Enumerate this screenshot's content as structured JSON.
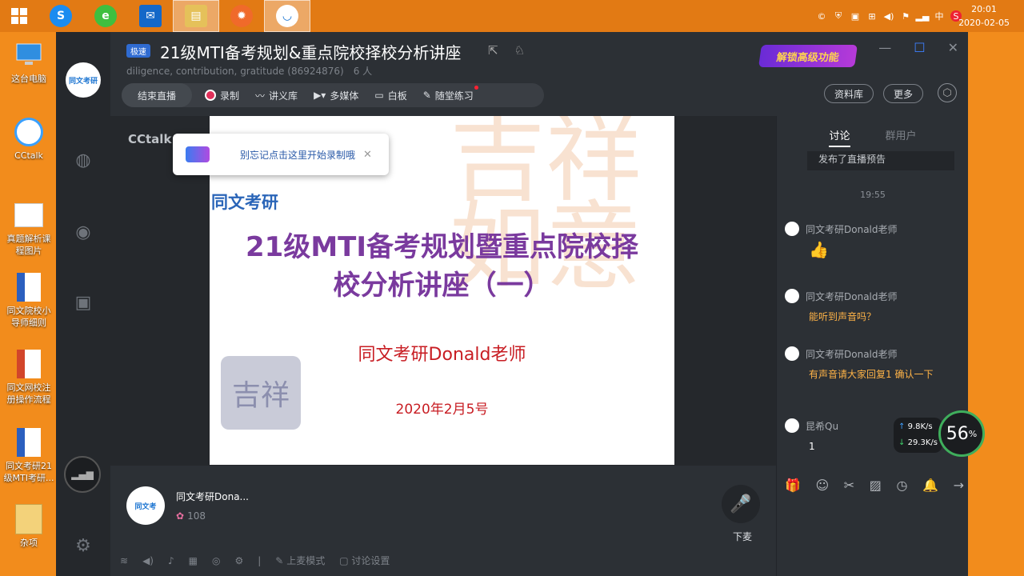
{
  "taskbar": {
    "tray_lang": "中",
    "tray_s": "S",
    "time": "20:01",
    "date": "2020-02-05"
  },
  "desktop": {
    "icons": [
      "这台电脑",
      "CCtalk",
      "真题解析课程图片",
      "同文院校小导师细则",
      "同文网校注册操作流程",
      "同文考研21级MTI考研...",
      "杂项"
    ]
  },
  "header": {
    "badge": "极速",
    "title": "21级MTI备考规划&重点院校择校分析讲座",
    "subtitle": "diligence, contribution, gratitude (86924876)",
    "member_count": "6 人",
    "unlock_label": "解锁高级功能"
  },
  "toolbar": {
    "end_live": "结束直播",
    "record": "录制",
    "handout": "讲义库",
    "multimedia": "多媒体",
    "whiteboard": "白板",
    "exercise": "随堂练习",
    "materials": "资料库",
    "more": "更多"
  },
  "stage": {
    "watermark": "CCtalk",
    "tip_text": "别忘记点击这里开始录制哦"
  },
  "slide": {
    "brand": "同文考研",
    "title_line1": "21级MTI备考规划暨重点院校择",
    "title_line2": "校分析讲座（一）",
    "speaker": "同文考研Donald老师",
    "date": "2020年2月5号"
  },
  "host": {
    "name": "同文考研Dona...",
    "flowers": "108",
    "mic_label": "下麦"
  },
  "bottom_controls": {
    "mic_mode": "上麦模式",
    "chat_settings": "讨论设置"
  },
  "chat": {
    "tabs": [
      "讨论",
      "群用户"
    ],
    "notice": "发布了直播预告",
    "time": "19:55",
    "messages": [
      {
        "name": "同文考研Donald老师",
        "text": "👍"
      },
      {
        "name": "同文考研Donald老师",
        "text": "能听到声音吗？"
      },
      {
        "name": "同文考研Donald老师",
        "text": "有声音请大家回复1 确认一下"
      },
      {
        "name": "昆希Qu",
        "text": "1"
      }
    ],
    "upload_speed": "9.8K/s",
    "download_speed": "29.3K/s",
    "gauge_value": "56",
    "gauge_unit": "%"
  }
}
